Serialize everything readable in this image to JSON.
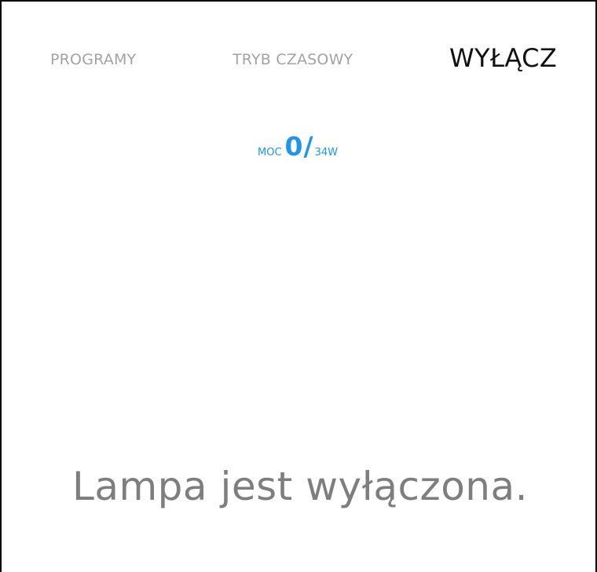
{
  "tabs": {
    "programs": "PROGRAMY",
    "timer": "TRYB CZASOWY",
    "off": "WYŁĄCZ",
    "active": "off"
  },
  "power": {
    "label": "MOC",
    "value": "0",
    "separator": "/",
    "max": "34W"
  },
  "status": {
    "message": "Lampa jest wyłączona."
  },
  "colors": {
    "accent": "#2196e8",
    "inactive_tab": "#a3a3a3",
    "active_tab": "#111111",
    "status_text": "#7e7e7e"
  }
}
